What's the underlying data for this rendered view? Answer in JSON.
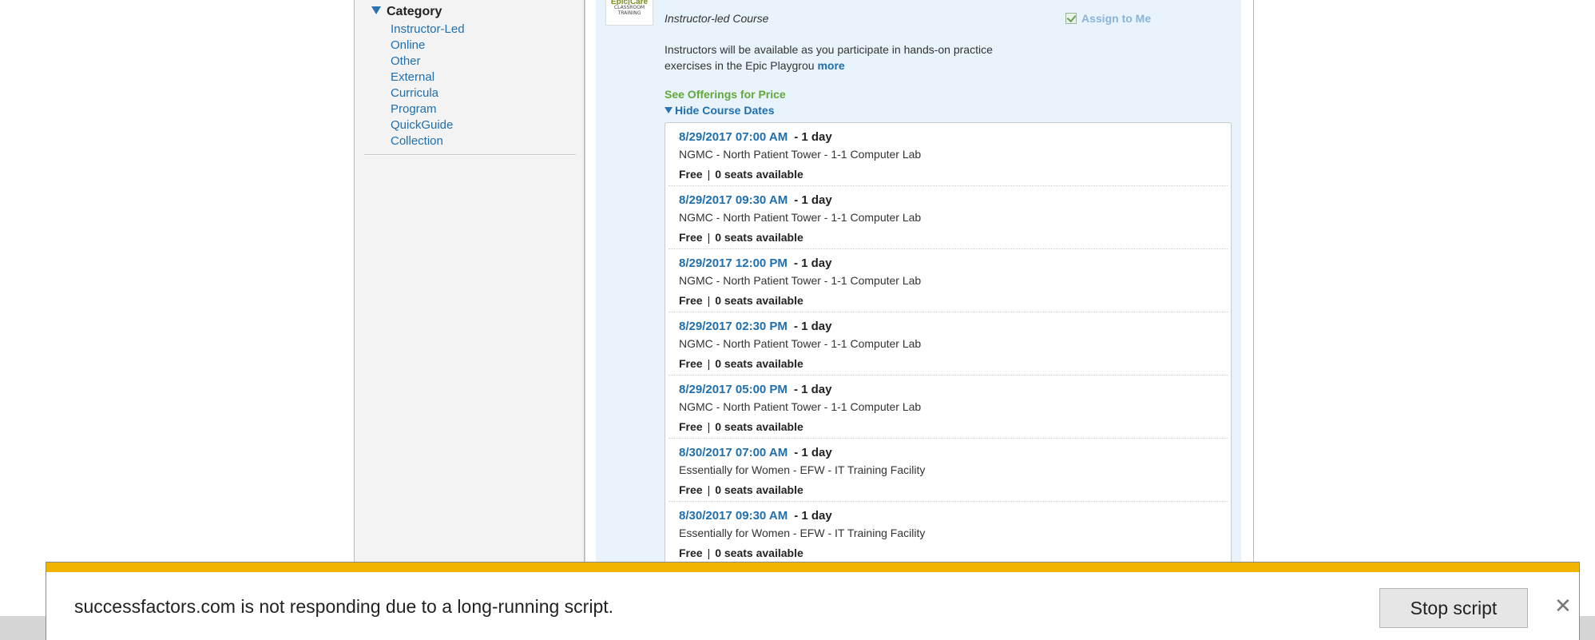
{
  "sidebar": {
    "category_header": "Category",
    "items": [
      {
        "label": "Instructor-Led"
      },
      {
        "label": "Online"
      },
      {
        "label": "Other"
      },
      {
        "label": "External"
      },
      {
        "label": "Curricula"
      },
      {
        "label": "Program"
      },
      {
        "label": "QuickGuide"
      },
      {
        "label": "Collection"
      }
    ]
  },
  "course": {
    "thumbnail": {
      "top": "Epic|Care",
      "sub": "CLASSROOM TRAINING"
    },
    "type": "Instructor-led Course",
    "assign_label": "Assign to Me",
    "description": "Instructors will be available as you participate in hands-on practice exercises in the Epic Playgrou",
    "more_label": "more",
    "price_link": "See Offerings for Price",
    "hide_dates_label": "Hide Course Dates",
    "offerings": [
      {
        "date": "8/29/2017 07:00 AM",
        "duration": "- 1 day",
        "location": "NGMC - North Patient Tower - 1-1 Computer Lab",
        "price": "Free",
        "seats": "0 seats available"
      },
      {
        "date": "8/29/2017 09:30 AM",
        "duration": "- 1 day",
        "location": "NGMC - North Patient Tower - 1-1 Computer Lab",
        "price": "Free",
        "seats": "0 seats available"
      },
      {
        "date": "8/29/2017 12:00 PM",
        "duration": "- 1 day",
        "location": "NGMC - North Patient Tower - 1-1 Computer Lab",
        "price": "Free",
        "seats": "0 seats available"
      },
      {
        "date": "8/29/2017 02:30 PM",
        "duration": "- 1 day",
        "location": "NGMC - North Patient Tower - 1-1 Computer Lab",
        "price": "Free",
        "seats": "0 seats available"
      },
      {
        "date": "8/29/2017 05:00 PM",
        "duration": "- 1 day",
        "location": "NGMC - North Patient Tower - 1-1 Computer Lab",
        "price": "Free",
        "seats": "0 seats available"
      },
      {
        "date": "8/30/2017 07:00 AM",
        "duration": "- 1 day",
        "location": "Essentially for Women - EFW - IT Training Facility",
        "price": "Free",
        "seats": "0 seats available"
      },
      {
        "date": "8/30/2017 09:30 AM",
        "duration": "- 1 day",
        "location": "Essentially for Women - EFW - IT Training Facility",
        "price": "Free",
        "seats": "0 seats available"
      }
    ]
  },
  "notification": {
    "message": "successfactors.com is not responding due to a long-running script.",
    "stop_label": "Stop script",
    "close_glyph": "✕"
  },
  "colors": {
    "link": "#1f6fae",
    "price_green": "#62a83a",
    "warning_stripe": "#f0b400",
    "card_bg": "#e9f3fc"
  }
}
